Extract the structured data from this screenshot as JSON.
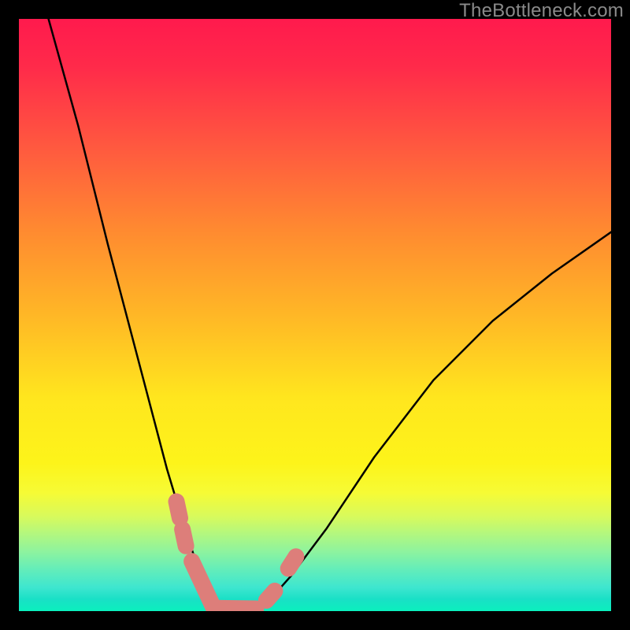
{
  "watermark": "TheBottleneck.com",
  "chart_data": {
    "type": "line",
    "title": "",
    "xlabel": "",
    "ylabel": "",
    "xlim": [
      0,
      100
    ],
    "ylim": [
      0,
      100
    ],
    "grid": false,
    "legend": false,
    "background": "rainbow-gradient-vertical",
    "series": [
      {
        "name": "bottleneck-curve",
        "x": [
          5,
          10,
          15,
          20,
          25,
          28,
          30,
          32,
          34,
          35,
          36,
          38,
          40,
          42,
          46,
          52,
          60,
          70,
          80,
          90,
          100
        ],
        "y": [
          100,
          82,
          62,
          43,
          24,
          14,
          8,
          3.5,
          1,
          0.3,
          0,
          0,
          0.3,
          1.5,
          6,
          14,
          26,
          39,
          49,
          57,
          64
        ]
      }
    ],
    "highlight_segments": [
      {
        "name": "left-marker-upper",
        "x": [
          26.6,
          27.2
        ],
        "y": [
          18.5,
          15.7
        ]
      },
      {
        "name": "left-marker-lower",
        "x": [
          27.6,
          28.2
        ],
        "y": [
          13.8,
          11.0
        ]
      },
      {
        "name": "valley-left-slope",
        "x": [
          29.2,
          32.9
        ],
        "y": [
          8.4,
          0.5
        ]
      },
      {
        "name": "valley-floor",
        "x": [
          32.9,
          40.0
        ],
        "y": [
          0.5,
          0.4
        ]
      },
      {
        "name": "right-marker-lower",
        "x": [
          41.8,
          43.2
        ],
        "y": [
          1.8,
          3.4
        ]
      },
      {
        "name": "right-marker-upper",
        "x": [
          45.5,
          46.8
        ],
        "y": [
          7.2,
          9.2
        ]
      }
    ]
  }
}
